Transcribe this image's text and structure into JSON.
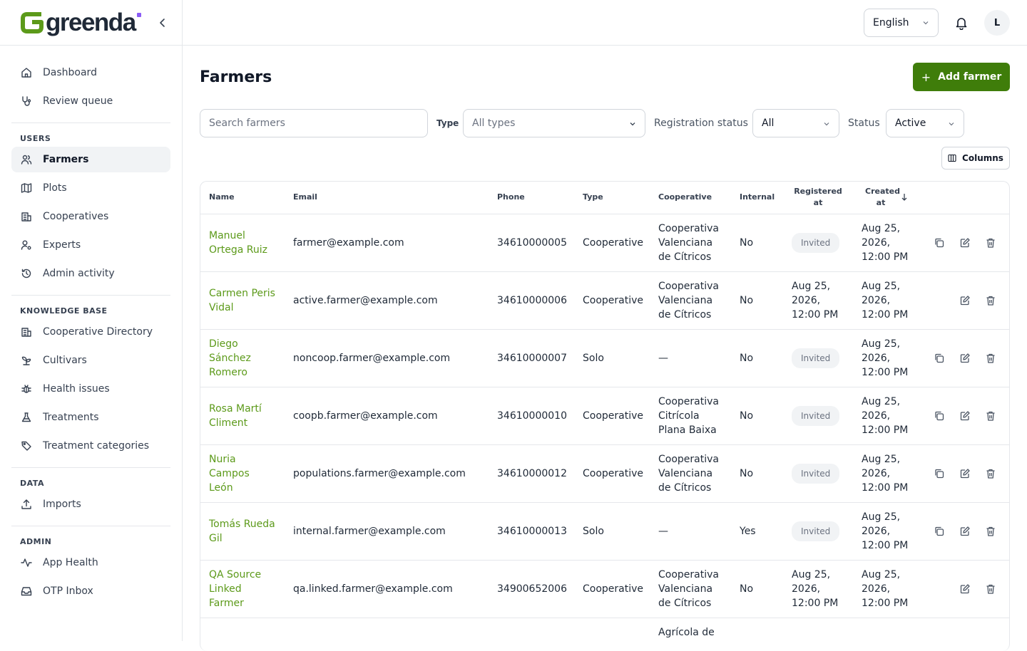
{
  "app": {
    "logo_text": "greenda",
    "brand_color": "#3f7d0a",
    "link_color": "#5c9a1a"
  },
  "sidebar": {
    "main_items": [
      {
        "label": "Dashboard",
        "icon": "home-icon"
      },
      {
        "label": "Review queue",
        "icon": "stethoscope-icon"
      }
    ],
    "sections": [
      {
        "title": "USERS",
        "items": [
          {
            "label": "Farmers",
            "icon": "users-icon",
            "active": true
          },
          {
            "label": "Plots",
            "icon": "map-icon"
          },
          {
            "label": "Cooperatives",
            "icon": "building-icon"
          },
          {
            "label": "Experts",
            "icon": "user-cog-icon"
          },
          {
            "label": "Admin activity",
            "icon": "history-icon"
          }
        ]
      },
      {
        "title": "KNOWLEDGE BASE",
        "items": [
          {
            "label": "Cooperative Directory",
            "icon": "building-icon"
          },
          {
            "label": "Cultivars",
            "icon": "sprout-icon"
          },
          {
            "label": "Health issues",
            "icon": "bug-icon"
          },
          {
            "label": "Treatments",
            "icon": "flask-icon"
          },
          {
            "label": "Treatment categories",
            "icon": "tag-icon"
          }
        ]
      },
      {
        "title": "DATA",
        "items": [
          {
            "label": "Imports",
            "icon": "upload-icon"
          }
        ]
      },
      {
        "title": "ADMIN",
        "items": [
          {
            "label": "App Health",
            "icon": "activity-icon"
          },
          {
            "label": "OTP Inbox",
            "icon": "inbox-icon"
          }
        ]
      }
    ]
  },
  "header": {
    "language": "English",
    "avatar_initial": "L"
  },
  "page": {
    "title": "Farmers",
    "add_button": "Add farmer",
    "columns_button": "Columns"
  },
  "filters": {
    "search_placeholder": "Search farmers",
    "type_label": "Type",
    "type_value": "All types",
    "registration_label": "Registration status",
    "registration_value": "All",
    "status_label": "Status",
    "status_value": "Active"
  },
  "table": {
    "headers": {
      "name": "Name",
      "email": "Email",
      "phone": "Phone",
      "type": "Type",
      "cooperative": "Cooperative",
      "internal": "Internal",
      "registered": "Registered at",
      "created": "Created at"
    },
    "rows": [
      {
        "name": "Manuel Ortega Ruiz",
        "email": "farmer@example.com",
        "phone": "34610000005",
        "type": "Cooperative",
        "cooperative": "Cooperativa Valenciana de Cítricos",
        "internal": "No",
        "registered": "Invited",
        "registered_is_badge": true,
        "created": "Aug 25, 2026, 12:00 PM",
        "copy": true
      },
      {
        "name": "Carmen Peris Vidal",
        "email": "active.farmer@example.com",
        "phone": "34610000006",
        "type": "Cooperative",
        "cooperative": "Cooperativa Valenciana de Cítricos",
        "internal": "No",
        "registered": "Aug 25, 2026, 12:00 PM",
        "registered_is_badge": false,
        "created": "Aug 25, 2026, 12:00 PM",
        "copy": false
      },
      {
        "name": "Diego Sánchez Romero",
        "email": "noncoop.farmer@example.com",
        "phone": "34610000007",
        "type": "Solo",
        "cooperative": "—",
        "internal": "No",
        "registered": "Invited",
        "registered_is_badge": true,
        "created": "Aug 25, 2026, 12:00 PM",
        "copy": true
      },
      {
        "name": "Rosa Martí Climent",
        "email": "coopb.farmer@example.com",
        "phone": "34610000010",
        "type": "Cooperative",
        "cooperative": "Cooperativa Citrícola Plana Baixa",
        "internal": "No",
        "registered": "Invited",
        "registered_is_badge": true,
        "created": "Aug 25, 2026, 12:00 PM",
        "copy": true
      },
      {
        "name": "Nuria Campos León",
        "email": "populations.farmer@example.com",
        "phone": "34610000012",
        "type": "Cooperative",
        "cooperative": "Cooperativa Valenciana de Cítricos",
        "internal": "No",
        "registered": "Invited",
        "registered_is_badge": true,
        "created": "Aug 25, 2026, 12:00 PM",
        "copy": true
      },
      {
        "name": "Tomás Rueda Gil",
        "email": "internal.farmer@example.com",
        "phone": "34610000013",
        "type": "Solo",
        "cooperative": "—",
        "internal": "Yes",
        "registered": "Invited",
        "registered_is_badge": true,
        "created": "Aug 25, 2026, 12:00 PM",
        "copy": true
      },
      {
        "name": "QA Source Linked Farmer",
        "email": "qa.linked.farmer@example.com",
        "phone": "34900652006",
        "type": "Cooperative",
        "cooperative": "Cooperativa Valenciana de Cítricos",
        "internal": "No",
        "registered": "Aug 25, 2026, 12:00 PM",
        "registered_is_badge": false,
        "created": "Aug 25, 2026, 12:00 PM",
        "copy": false
      },
      {
        "name": "",
        "email": "",
        "phone": "",
        "type": "",
        "cooperative": "Agrícola de",
        "internal": "",
        "registered": "",
        "registered_is_badge": false,
        "created": "",
        "copy": false,
        "partial": true
      }
    ]
  }
}
